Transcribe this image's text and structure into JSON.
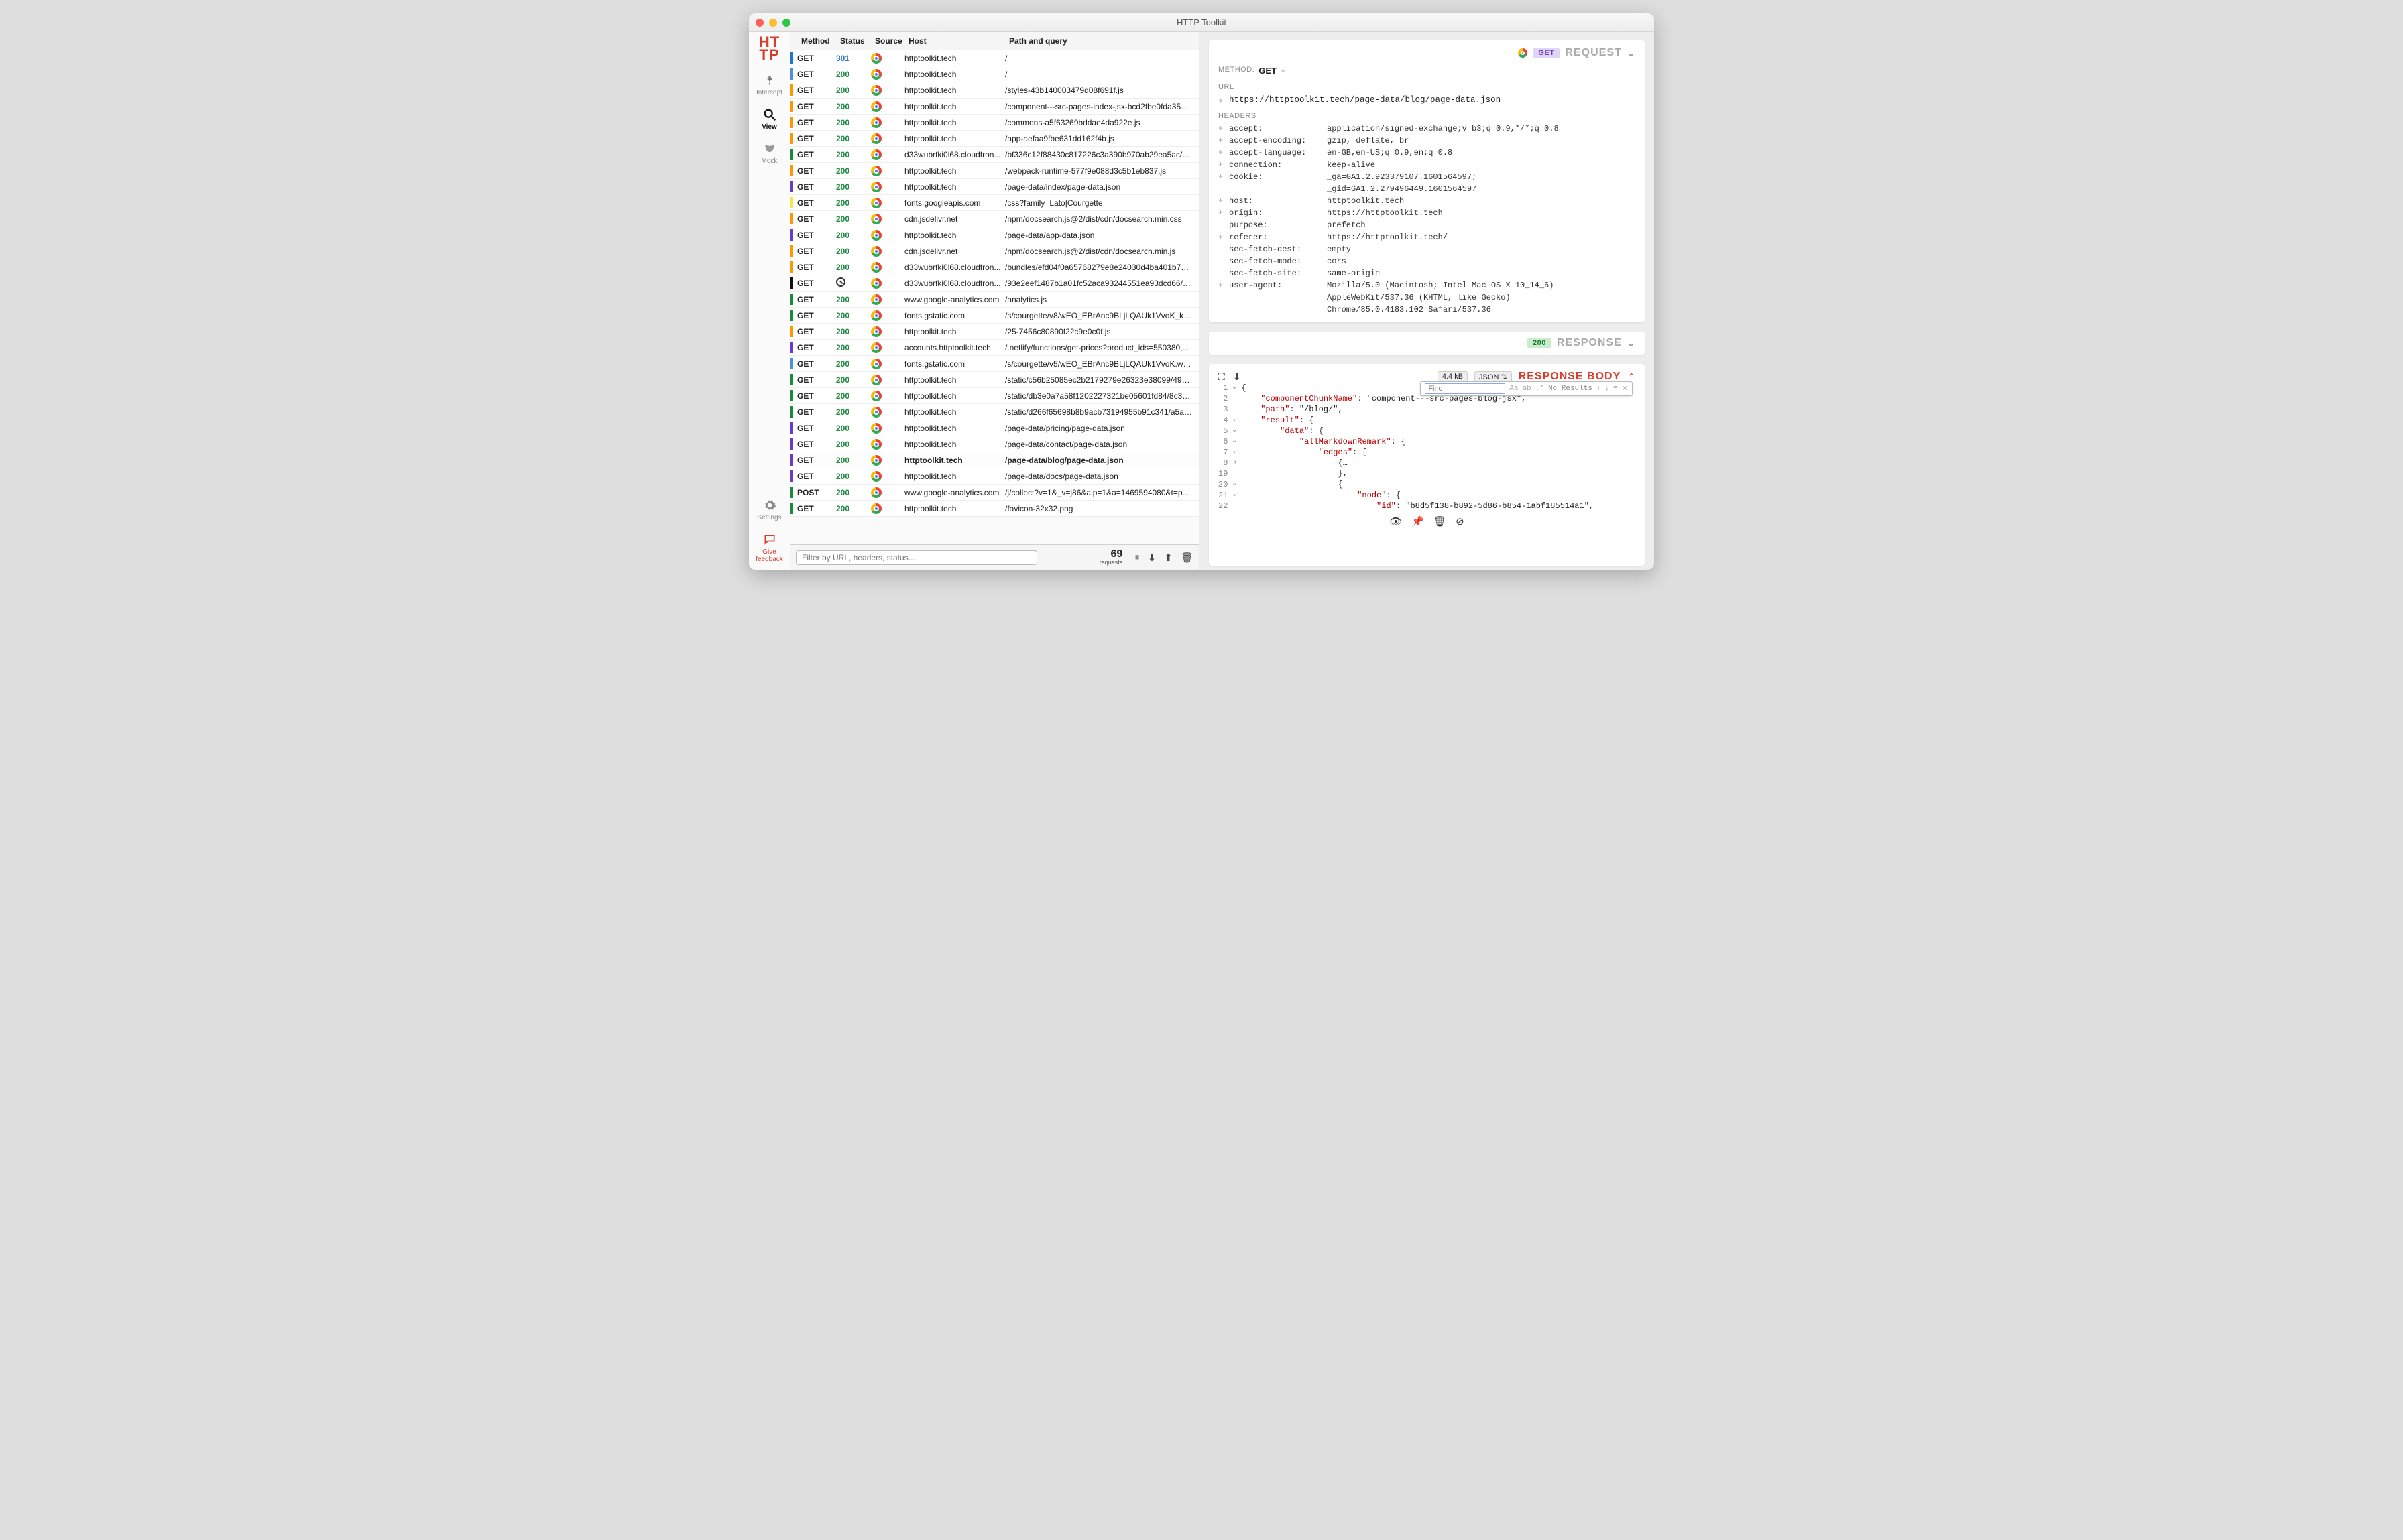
{
  "window_title": "HTTP Toolkit",
  "logo_lines": [
    "HT",
    "TP"
  ],
  "sidebar": {
    "items": [
      {
        "label": "Intercept",
        "icon": "plug-icon",
        "active": false
      },
      {
        "label": "View",
        "icon": "search-icon",
        "active": true
      },
      {
        "label": "Mock",
        "icon": "mask-icon",
        "active": false
      }
    ],
    "settings_label": "Settings",
    "feedback_line1": "Give",
    "feedback_line2": "feedback"
  },
  "table": {
    "headers": {
      "method": "Method",
      "status": "Status",
      "source": "Source",
      "host": "Host",
      "path": "Path and query"
    },
    "rows": [
      {
        "bar": "#1f77d0",
        "method": "GET",
        "status": "301",
        "status_cls": "status-301",
        "host": "httptoolkit.tech",
        "path": "/"
      },
      {
        "bar": "#4a90e2",
        "method": "GET",
        "status": "200",
        "status_cls": "status-200",
        "host": "httptoolkit.tech",
        "path": "/"
      },
      {
        "bar": "#ff9800",
        "method": "GET",
        "status": "200",
        "status_cls": "status-200",
        "host": "httptoolkit.tech",
        "path": "/styles-43b140003479d08f691f.js"
      },
      {
        "bar": "#ff9800",
        "method": "GET",
        "status": "200",
        "status_cls": "status-200",
        "host": "httptoolkit.tech",
        "path": "/component---src-pages-index-jsx-bcd2fbe0fda3553ed..."
      },
      {
        "bar": "#ff9800",
        "method": "GET",
        "status": "200",
        "status_cls": "status-200",
        "host": "httptoolkit.tech",
        "path": "/commons-a5f63269bddae4da922e.js"
      },
      {
        "bar": "#ff9800",
        "method": "GET",
        "status": "200",
        "status_cls": "status-200",
        "host": "httptoolkit.tech",
        "path": "/app-aefaa9fbe631dd162f4b.js"
      },
      {
        "bar": "#1a8a3e",
        "method": "GET",
        "status": "200",
        "status_cls": "status-200",
        "host": "d33wubrfki0l68.cloudfron...",
        "path": "/bf336c12f88430c817226c3a390b970ab29ea5ac/d4..."
      },
      {
        "bar": "#ff9800",
        "method": "GET",
        "status": "200",
        "status_cls": "status-200",
        "host": "httptoolkit.tech",
        "path": "/webpack-runtime-577f9e088d3c5b1eb837.js"
      },
      {
        "bar": "#6a3cc4",
        "method": "GET",
        "status": "200",
        "status_cls": "status-200",
        "host": "httptoolkit.tech",
        "path": "/page-data/index/page-data.json"
      },
      {
        "bar": "#f7e648",
        "method": "GET",
        "status": "200",
        "status_cls": "status-200",
        "host": "fonts.googleapis.com",
        "path": "/css?family=Lato|Courgette"
      },
      {
        "bar": "#ff9800",
        "method": "GET",
        "status": "200",
        "status_cls": "status-200",
        "host": "cdn.jsdelivr.net",
        "path": "/npm/docsearch.js@2/dist/cdn/docsearch.min.css"
      },
      {
        "bar": "#6a3cc4",
        "method": "GET",
        "status": "200",
        "status_cls": "status-200",
        "host": "httptoolkit.tech",
        "path": "/page-data/app-data.json"
      },
      {
        "bar": "#ff9800",
        "method": "GET",
        "status": "200",
        "status_cls": "status-200",
        "host": "cdn.jsdelivr.net",
        "path": "/npm/docsearch.js@2/dist/cdn/docsearch.min.js"
      },
      {
        "bar": "#ff9800",
        "method": "GET",
        "status": "200",
        "status_cls": "status-200",
        "host": "d33wubrfki0l68.cloudfron...",
        "path": "/bundles/efd04f0a65768279e8e24030d4ba401b7196..."
      },
      {
        "bar": "#111",
        "method": "GET",
        "status": "blocked",
        "status_cls": "status-blocked",
        "host": "d33wubrfki0l68.cloudfron...",
        "path": "/93e2eef1487b1a01fc52aca93244551ea93dcd66/9d..."
      },
      {
        "bar": "#1a8a3e",
        "method": "GET",
        "status": "200",
        "status_cls": "status-200",
        "host": "www.google-analytics.com",
        "path": "/analytics.js"
      },
      {
        "bar": "#1a8a3e",
        "method": "GET",
        "status": "200",
        "status_cls": "status-200",
        "host": "fonts.gstatic.com",
        "path": "/s/courgette/v8/wEO_EBrAnc9BLjLQAUk1VvoK_kgXi..."
      },
      {
        "bar": "#ff9800",
        "method": "GET",
        "status": "200",
        "status_cls": "status-200",
        "host": "httptoolkit.tech",
        "path": "/25-7456c80890f22c9e0c0f.js"
      },
      {
        "bar": "#6a3cc4",
        "method": "GET",
        "status": "200",
        "status_cls": "status-200",
        "host": "accounts.httptoolkit.tech",
        "path": "/.netlify/functions/get-prices?product_ids=550380,55..."
      },
      {
        "bar": "#4a90e2",
        "method": "GET",
        "status": "200",
        "status_cls": "status-200",
        "host": "fonts.gstatic.com",
        "path": "/s/courgette/v5/wEO_EBrAnc9BLjLQAUk1VvoK.woff2"
      },
      {
        "bar": "#1a8a3e",
        "method": "GET",
        "status": "200",
        "status_cls": "status-200",
        "host": "httptoolkit.tech",
        "path": "/static/c56b25085ec2b2179279e26323e38099/49af..."
      },
      {
        "bar": "#1a8a3e",
        "method": "GET",
        "status": "200",
        "status_cls": "status-200",
        "host": "httptoolkit.tech",
        "path": "/static/db3e0a7a58f1202227321be05601fd84/8c335..."
      },
      {
        "bar": "#1a8a3e",
        "method": "GET",
        "status": "200",
        "status_cls": "status-200",
        "host": "httptoolkit.tech",
        "path": "/static/d266f65698b8b9acb73194955b91c341/a5a19..."
      },
      {
        "bar": "#6a3cc4",
        "method": "GET",
        "status": "200",
        "status_cls": "status-200",
        "host": "httptoolkit.tech",
        "path": "/page-data/pricing/page-data.json"
      },
      {
        "bar": "#6a3cc4",
        "method": "GET",
        "status": "200",
        "status_cls": "status-200",
        "host": "httptoolkit.tech",
        "path": "/page-data/contact/page-data.json"
      },
      {
        "bar": "#6a3cc4",
        "method": "GET",
        "status": "200",
        "status_cls": "status-200",
        "host": "httptoolkit.tech",
        "path": "/page-data/blog/page-data.json",
        "selected": true
      },
      {
        "bar": "#6a3cc4",
        "method": "GET",
        "status": "200",
        "status_cls": "status-200",
        "host": "httptoolkit.tech",
        "path": "/page-data/docs/page-data.json"
      },
      {
        "bar": "#1a8a3e",
        "method": "POST",
        "status": "200",
        "status_cls": "status-200",
        "host": "www.google-analytics.com",
        "path": "/j/collect?v=1&_v=j86&aip=1&a=1469594080&t=page..."
      },
      {
        "bar": "#1a8a3e",
        "method": "GET",
        "status": "200",
        "status_cls": "status-200",
        "host": "httptoolkit.tech",
        "path": "/favicon-32x32.png"
      }
    ]
  },
  "filter": {
    "placeholder": "Filter by URL, headers, status...",
    "count": "69",
    "count_label": "requests"
  },
  "request": {
    "title": "REQUEST",
    "chev": "⌄",
    "method_badge": "GET",
    "method_label": "METHOD:",
    "method_value": "GET",
    "url_label": "URL",
    "url": "https://httptoolkit.tech/page-data/blog/page-data.json",
    "headers_label": "HEADERS",
    "headers": [
      {
        "plus": "+",
        "key": "accept:",
        "val": "application/signed-exchange;v=b3;q=0.9,*/*;q=0.8"
      },
      {
        "plus": "+",
        "key": "accept-encoding:",
        "val": "gzip, deflate, br"
      },
      {
        "plus": "+",
        "key": "accept-language:",
        "val": "en-GB,en-US;q=0.9,en;q=0.8"
      },
      {
        "plus": "+",
        "key": "connection:",
        "val": "keep-alive"
      },
      {
        "plus": "+",
        "key": "cookie:",
        "val": "_ga=GA1.2.923379107.1601564597;\n_gid=GA1.2.279496449.1601564597"
      },
      {
        "plus": "+",
        "key": "host:",
        "val": "httptoolkit.tech"
      },
      {
        "plus": "+",
        "key": "origin:",
        "val": "https://httptoolkit.tech"
      },
      {
        "plus": "",
        "key": "purpose:",
        "val": "prefetch"
      },
      {
        "plus": "+",
        "key": "referer:",
        "val": "https://httptoolkit.tech/"
      },
      {
        "plus": "",
        "key": "sec-fetch-dest:",
        "val": "empty"
      },
      {
        "plus": "",
        "key": "sec-fetch-mode:",
        "val": "cors"
      },
      {
        "plus": "",
        "key": "sec-fetch-site:",
        "val": "same-origin"
      },
      {
        "plus": "+",
        "key": "user-agent:",
        "val": "Mozilla/5.0 (Macintosh; Intel Mac OS X 10_14_6)\nAppleWebKit/537.36 (KHTML, like Gecko)\nChrome/85.0.4183.102 Safari/537.36"
      }
    ]
  },
  "response": {
    "title": "RESPONSE",
    "status_badge": "200",
    "chev": "⌄",
    "body_title": "RESPONSE BODY",
    "body_chev": "⌃",
    "size": "4.4 kB",
    "format": "JSON ⇅",
    "find_placeholder": "Find",
    "find_results": "No Results",
    "gutter": [
      "1",
      "2",
      "3",
      "4",
      "5",
      "6",
      "7",
      "8",
      "19",
      "20",
      "21",
      "22"
    ],
    "folds": [
      "⌄",
      "",
      "",
      "⌄",
      "⌄",
      "⌄",
      "⌄",
      "›",
      "",
      "⌄",
      "⌄",
      ""
    ],
    "code_lines": [
      "{",
      "    \"componentChunkName\": \"component---src-pages-blog-jsx\",",
      "    \"path\": \"/blog/\",",
      "    \"result\": {",
      "        \"data\": {",
      "            \"allMarkdownRemark\": {",
      "                \"edges\": [",
      "                    {…",
      "                    },",
      "                    {",
      "                        \"node\": {",
      "                            \"id\": \"b8d5f138-b892-5d86-b854-1abf185514a1\","
    ]
  }
}
